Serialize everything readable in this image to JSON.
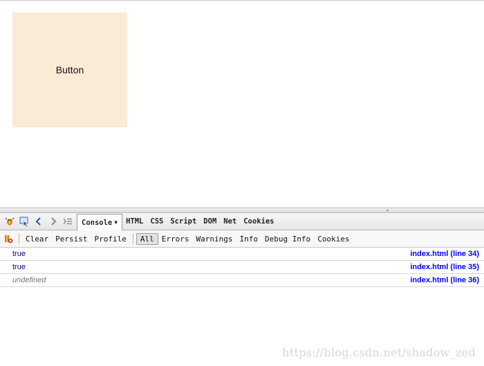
{
  "page": {
    "button_label": "Button"
  },
  "firebug": {
    "tabs": [
      {
        "label": "Console",
        "selected": true
      },
      {
        "label": "HTML"
      },
      {
        "label": "CSS"
      },
      {
        "label": "Script"
      },
      {
        "label": "DOM"
      },
      {
        "label": "Net"
      },
      {
        "label": "Cookies"
      }
    ],
    "toolbar": {
      "clear": "Clear",
      "persist": "Persist",
      "profile": "Profile",
      "filters": [
        "All",
        "Errors",
        "Warnings",
        "Info",
        "Debug Info",
        "Cookies"
      ],
      "active_filter": "All"
    },
    "console_rows": [
      {
        "value": "true",
        "source": "index.html (line 34)"
      },
      {
        "value": "true",
        "source": "index.html (line 35)"
      },
      {
        "value": "undefined",
        "source": "index.html (line 36)"
      }
    ]
  },
  "watermark": "https://blog.csdn.net/shadow_zed",
  "colors": {
    "button_bg": "#faebd7",
    "link": "#0000ff",
    "value": "#000088"
  },
  "icons": [
    "firebug-icon",
    "inspect-icon",
    "back-icon",
    "forward-icon",
    "command-line-icon",
    "error-breakpoint-icon"
  ]
}
